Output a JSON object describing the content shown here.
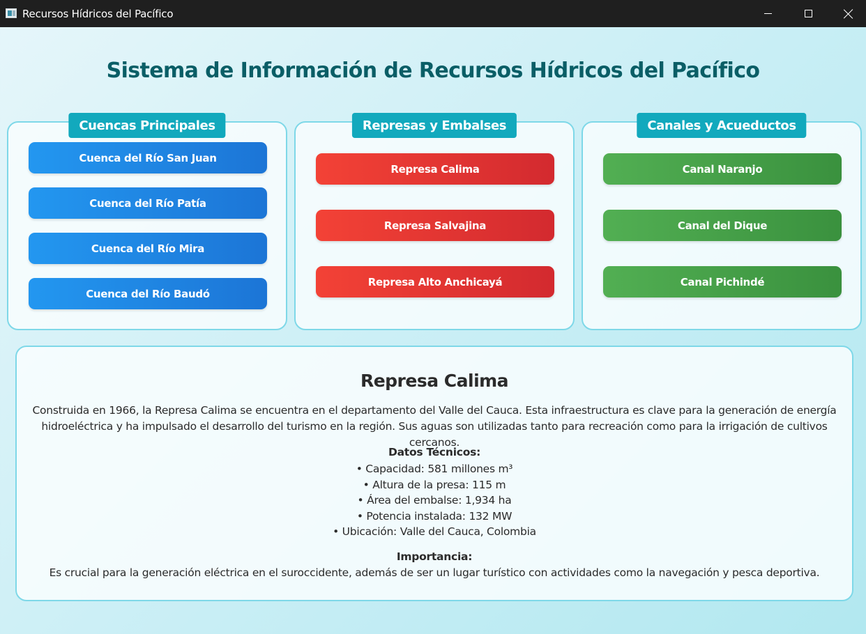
{
  "window": {
    "title": "Recursos Hídricos del Pacífico",
    "icons": {
      "app": "app-window-icon",
      "minimize": "minimize-icon",
      "maximize": "maximize-icon",
      "close": "close-icon"
    }
  },
  "page": {
    "title": "Sistema de Información de Recursos Hídricos del Pacífico"
  },
  "colors": {
    "heading": "#0a5e66",
    "tab": "#12a9bd",
    "panel_border": "#7ed8e8",
    "basins": "#2397f0",
    "dams": "#f34236",
    "canals": "#52af53"
  },
  "panels": [
    {
      "title": "Cuencas Principales",
      "items": [
        "Cuenca del Río San Juan",
        "Cuenca del Río Patía",
        "Cuenca del Río Mira",
        "Cuenca del Río Baudó"
      ]
    },
    {
      "title": "Represas y Embalses",
      "items": [
        "Represa Calima",
        "Represa Salvajina",
        "Represa Alto Anchicayá"
      ]
    },
    {
      "title": "Canales y Acueductos",
      "items": [
        "Canal Naranjo",
        "Canal del Dique",
        "Canal Pichindé"
      ]
    }
  ],
  "detail": {
    "title": "Represa Calima",
    "description": "Construida en 1966, la Represa Calima se encuentra en el departamento del Valle del Cauca. Esta infraestructura es clave para la generación de energía hidroeléctrica y ha impulsado el desarrollo del turismo en la región. Sus aguas son utilizadas tanto para recreación como para la irrigación de cultivos cercanos.",
    "tech_heading": "Datos Técnicos:",
    "tech_items": [
      "• Capacidad: 581 millones m³",
      "• Altura de la presa: 115 m",
      "• Área del embalse: 1,934 ha",
      "• Potencia instalada: 132 MW",
      "• Ubicación: Valle del Cauca, Colombia"
    ],
    "importance_heading": "Importancia:",
    "importance_text": "Es crucial para la generación eléctrica en el suroccidente, además de ser un lugar turístico con actividades como la navegación y pesca deportiva."
  }
}
